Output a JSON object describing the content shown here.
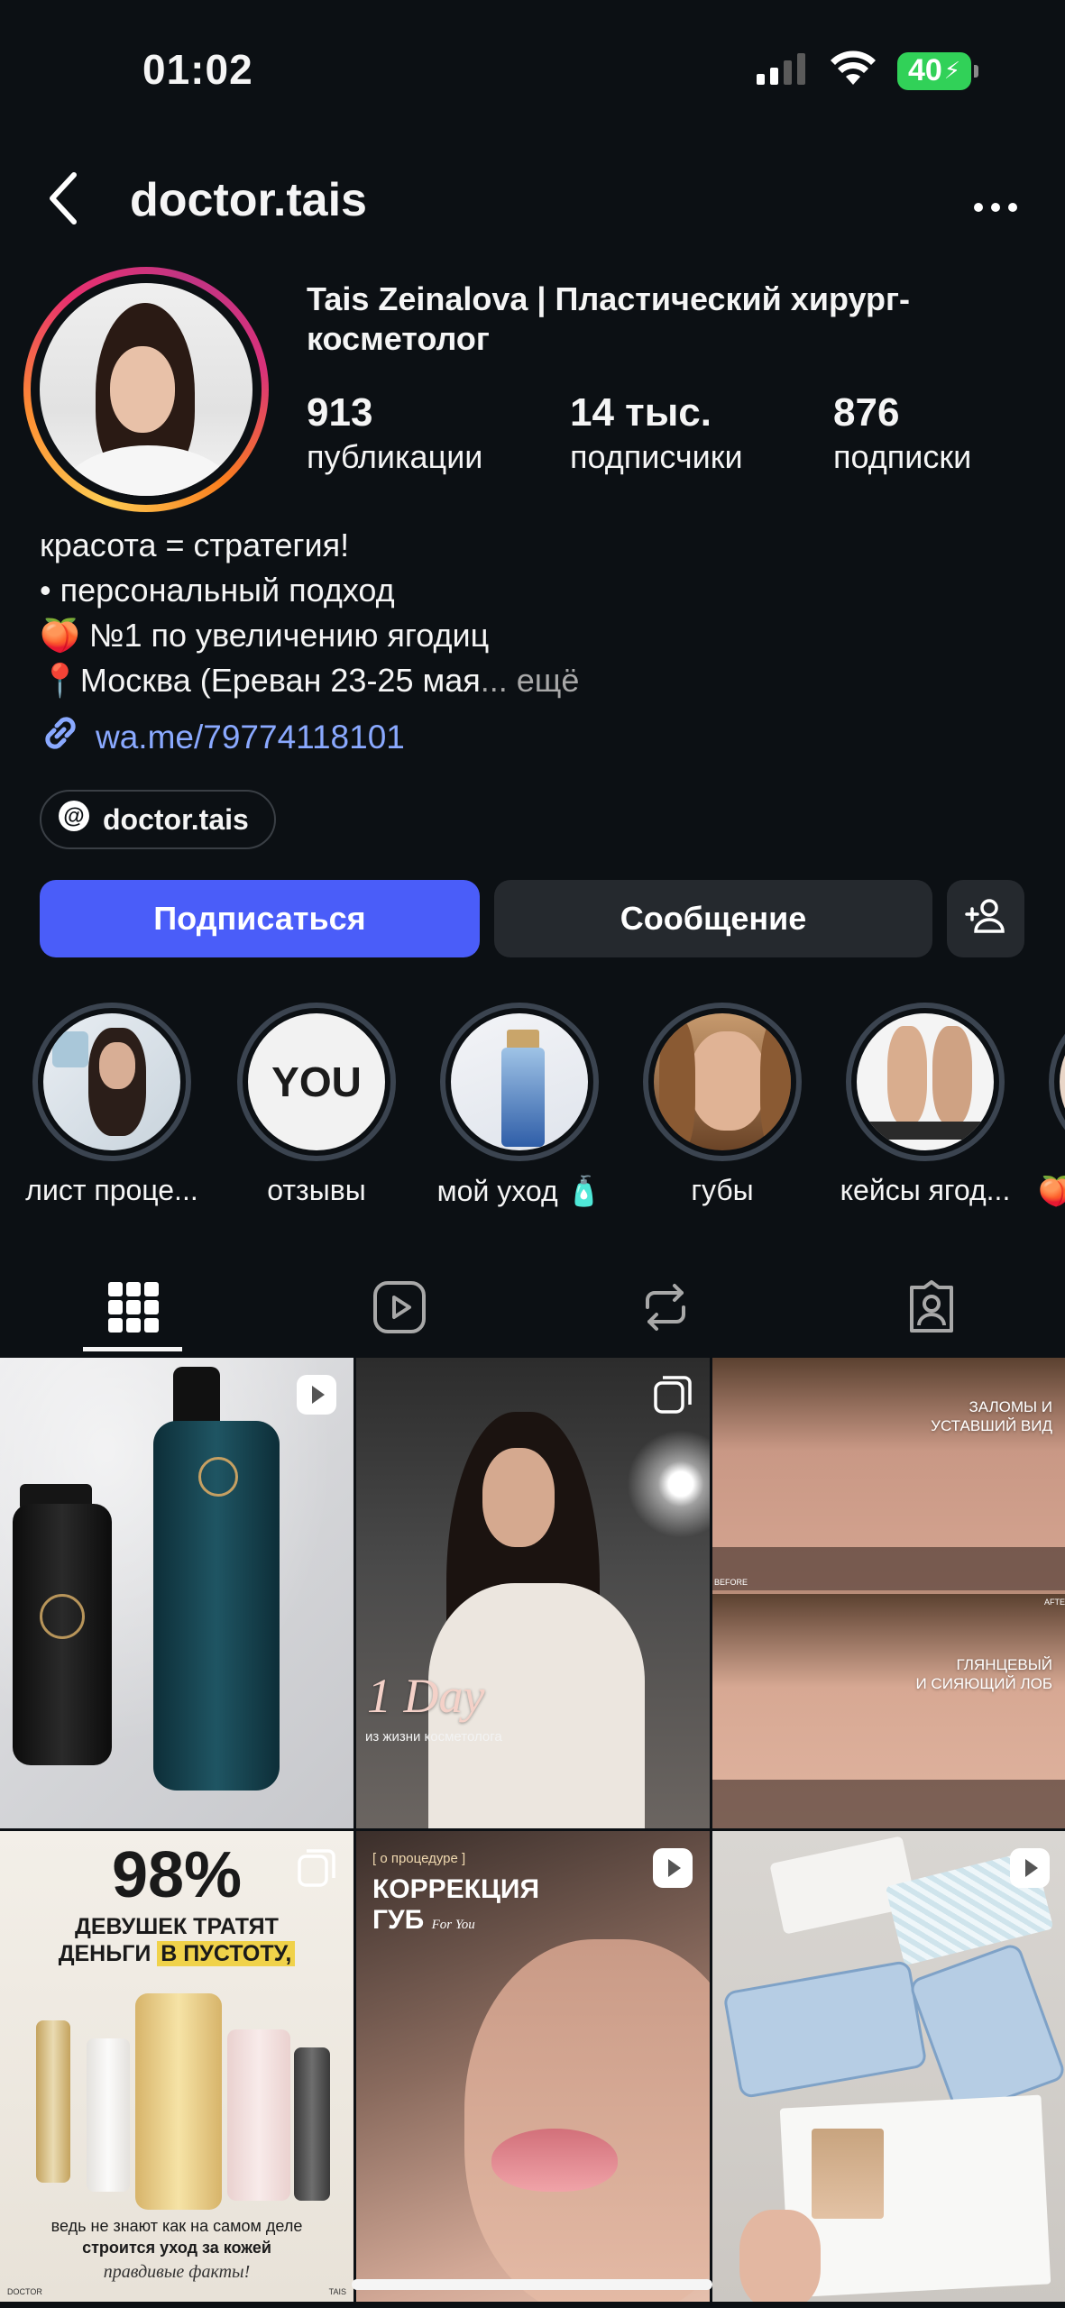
{
  "status_bar": {
    "time": "01:02",
    "battery": "40"
  },
  "header": {
    "username": "doctor.tais"
  },
  "profile": {
    "full_name": "Tais Zeinalova | Пластический хирург-косметолог",
    "stats": [
      {
        "value": "913",
        "label": "публикации"
      },
      {
        "value": "14 тыс.",
        "label": "подписчики"
      },
      {
        "value": "876",
        "label": "подписки"
      }
    ],
    "bio": {
      "line1": "красота = стратегия!",
      "line2": "• персональный подход",
      "line3": "🍑 №1 по увеличению ягодиц",
      "line4": "📍Москва (Ереван 23-25 мая",
      "more": "... ещё"
    },
    "link": "wa.me/79774118101",
    "threads": "doctor.tais"
  },
  "actions": {
    "follow": "Подписаться",
    "message": "Сообщение"
  },
  "highlights": [
    {
      "label": "лист проце..."
    },
    {
      "label": "отзывы",
      "cover_text": "YOU"
    },
    {
      "label": "мой уход 🧴"
    },
    {
      "label": "губы"
    },
    {
      "label": "кейсы ягод..."
    },
    {
      "label": "🍑"
    }
  ],
  "posts": {
    "p2": {
      "title": "1 Day",
      "subtitle": "из жизни косметолога"
    },
    "p3": {
      "top": "ЗАЛОМЫ И\nУСТАВШИЙ ВИД",
      "bottom": "ГЛЯНЦЕВЫЙ\nИ СИЯЮЩИЙ ЛОБ",
      "before": "BEFORE",
      "after": "AFTE"
    },
    "p4": {
      "big": "98%",
      "line1": "ДЕВУШЕК ТРАТЯТ",
      "line2a": "ДЕНЬГИ ",
      "line2b": "В ПУСТОТУ,",
      "footer1": "ведь не знают как на самом деле",
      "footer2": "строится уход за кожей",
      "footer3": "правдивые факты!",
      "brand_left": "DOCTOR",
      "brand_right": "TAIS"
    },
    "p5": {
      "tag": "[ о процедуре ]",
      "title1": "КОРРЕКЦИЯ",
      "title2": "ГУБ",
      "script": "For You"
    }
  },
  "colors": {
    "follow": "#4a5df9",
    "secondary": "#25292e",
    "link": "#8aa9ff",
    "background": "#0c1014"
  }
}
